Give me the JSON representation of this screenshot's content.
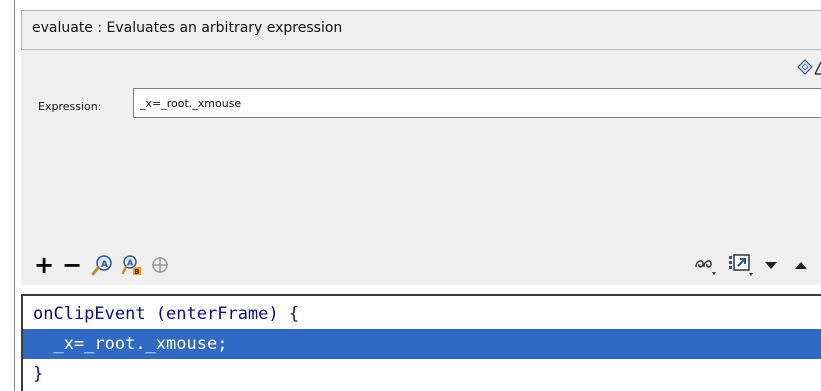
{
  "action": {
    "header": "evaluate : Evaluates an arbitrary expression"
  },
  "params": {
    "expression_label": "Expression:",
    "expression_value": "_x=_root._xmouse"
  },
  "toolbar": {
    "add_glyph": "+",
    "remove_glyph": "−",
    "icons": [
      "add-icon",
      "remove-icon",
      "find-icon",
      "replace-icon",
      "insert-target-path-icon",
      "debug-options-icon",
      "view-options-icon",
      "menu-arrow-icon",
      "collapse-arrow-icon"
    ]
  },
  "script": {
    "lines": [
      {
        "text": "onClipEvent (enterFrame) {",
        "selected": false
      },
      {
        "text": "  _x=_root._xmouse;",
        "selected": true
      },
      {
        "text": "}",
        "selected": false
      }
    ]
  },
  "colors": {
    "panel_bg": "#efefef",
    "selection": "#316ac5",
    "code_text": "#0a0a8a"
  }
}
